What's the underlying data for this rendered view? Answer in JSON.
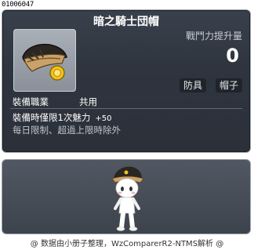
{
  "item_id": "01006047",
  "title": "暗之騎士団帽",
  "power": {
    "label": "戰鬥力提升量",
    "value": "0"
  },
  "tags": [
    "防具",
    "帽子"
  ],
  "job": {
    "label": "裝備職業",
    "value": "共用"
  },
  "desc": {
    "line1": "裝備時僅限1次魅力",
    "bonus": "+50",
    "line2": "每日限制、超過上限時除外"
  },
  "footer": "@ 数据由小册子整理，WzComparerR2-NTMS解析 @",
  "icons": {
    "item": "knight-hat-icon",
    "character": "character-preview"
  }
}
